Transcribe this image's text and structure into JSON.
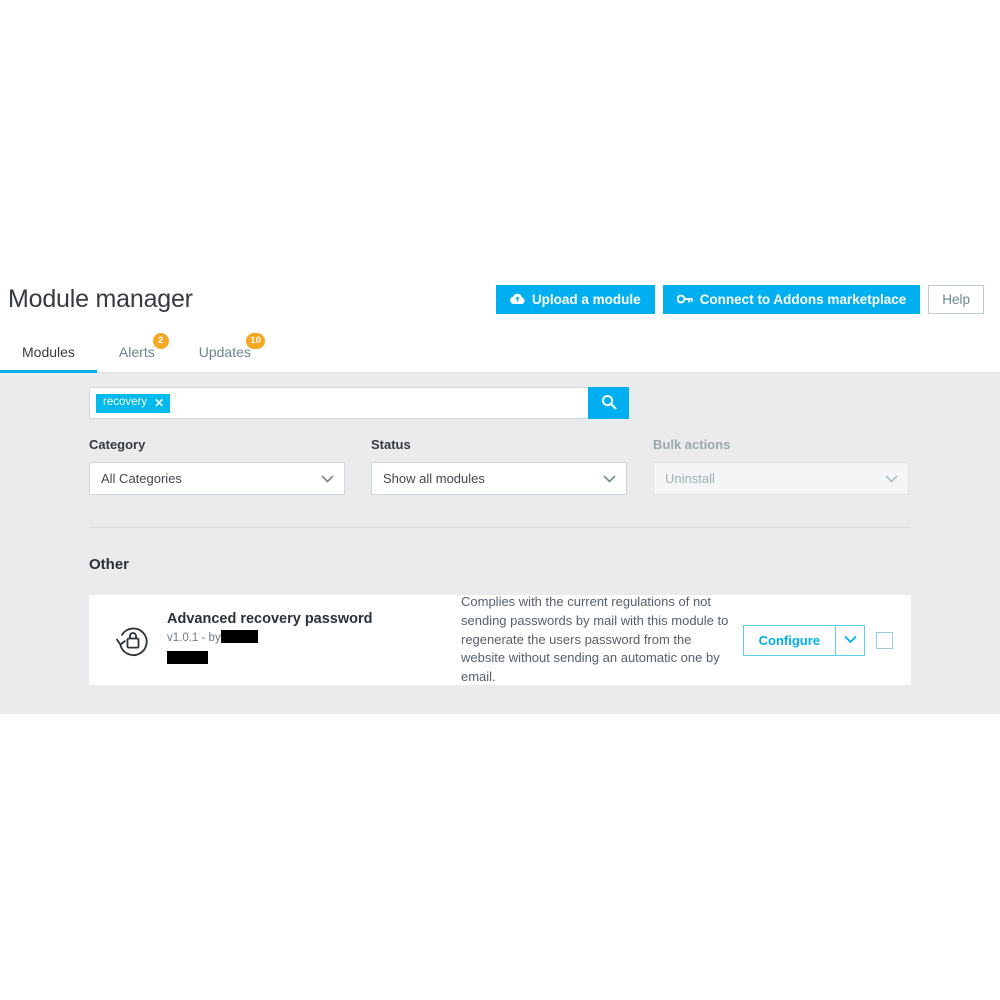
{
  "header": {
    "title": "Module manager",
    "upload_button": "Upload a module",
    "upload_icon": "cloud-upload-icon",
    "connect_button": "Connect to Addons marketplace",
    "connect_icon": "key-icon",
    "help_button": "Help"
  },
  "tabs": [
    {
      "label": "Modules",
      "badge": "",
      "active": true
    },
    {
      "label": "Alerts",
      "badge": "2",
      "active": false
    },
    {
      "label": "Updates",
      "badge": "10",
      "active": false
    }
  ],
  "search": {
    "chip_label": "recovery",
    "chip_remove_icon": "close-icon",
    "placeholder": "",
    "value": "",
    "search_icon": "search-icon"
  },
  "filters": {
    "category": {
      "label": "Category",
      "value": "All Categories"
    },
    "status": {
      "label": "Status",
      "value": "Show all modules"
    },
    "bulk": {
      "label": "Bulk actions",
      "value": "Uninstall",
      "disabled": true
    }
  },
  "section": {
    "title": "Other"
  },
  "module": {
    "icon": "password-recovery-icon",
    "name": "Advanced recovery password",
    "version_prefix": "v1.0.1 - by",
    "author_redacted": true,
    "description": "Complies with the current regulations of not sending passwords by mail with this module to regenerate the users password from the website without sending an automatic one by email.",
    "configure_label": "Configure",
    "caret_icon": "chevron-down-icon",
    "checkbox_checked": false
  },
  "colors": {
    "accent": "#00aff0",
    "chip": "#00b9ed",
    "badge": "#f5a623",
    "content_bg": "#eaebec",
    "text": "#363a41"
  }
}
